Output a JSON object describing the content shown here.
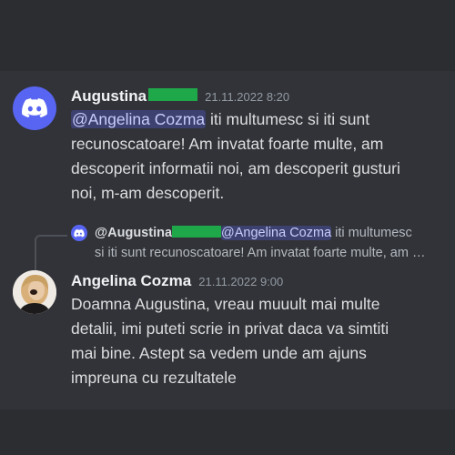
{
  "messages": [
    {
      "author": "Augustina",
      "timestamp": "21.11.2022 8:20",
      "mention": "@Angelina Cozma",
      "text_lines": [
        " iti multumesc si iti sunt",
        "recunoscatoare! Am invatat foarte multe, am",
        "descoperit informatii noi, am descoperit gusturi",
        "noi, m-am descoperit."
      ],
      "avatar_icon": "discord-logo-icon",
      "name_tag_color": "#1fa84a"
    },
    {
      "reply": {
        "author": "@Augustina",
        "mention": "@Angelina Cozma",
        "text_line1": " iti multumesc",
        "text_line2": "si iti sunt recunoscatoare! Am invatat foarte multe, am …"
      },
      "author": "Angelina Cozma",
      "timestamp": "21.11.2022 9:00",
      "text_lines": [
        "Doamna Augustina, vreau muuult mai multe",
        "detalii, imi puteti scrie in privat daca va simtiti",
        "mai bine. Astept sa vedem unde am ajuns",
        "impreuna cu rezultatele"
      ],
      "avatar_icon": "profile-photo"
    }
  ],
  "colors": {
    "accent": "#5865f2",
    "background": "#313338",
    "band": "#2b2d31"
  }
}
